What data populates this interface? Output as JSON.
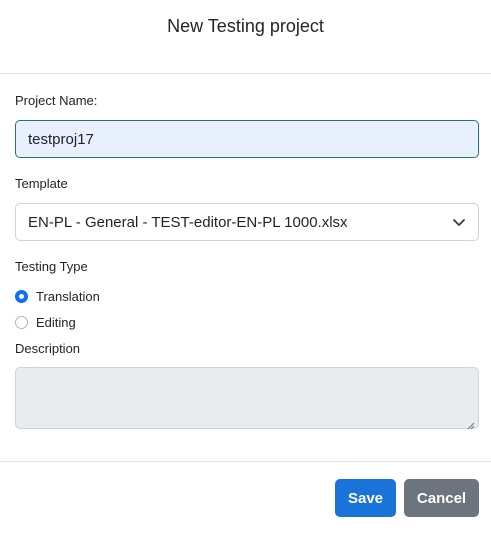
{
  "dialog": {
    "title": "New Testing project"
  },
  "form": {
    "project_name_label": "Project Name:",
    "project_name_value": "testproj17",
    "template_label": "Template",
    "template_value": "EN-PL - General - TEST-editor-EN-PL 1000.xlsx",
    "testing_type_label": "Testing Type",
    "testing_types": [
      {
        "label": "Translation",
        "checked": true
      },
      {
        "label": "Editing",
        "checked": false
      }
    ],
    "description_label": "Description",
    "description_value": ""
  },
  "footer": {
    "save_label": "Save",
    "cancel_label": "Cancel"
  },
  "colors": {
    "primary": "#1a73d9",
    "secondary": "#6c757d",
    "input_focus_border": "#1b7a6e",
    "input_autofill_bg": "#e8f0fe",
    "disabled_bg": "#e9ecef"
  }
}
